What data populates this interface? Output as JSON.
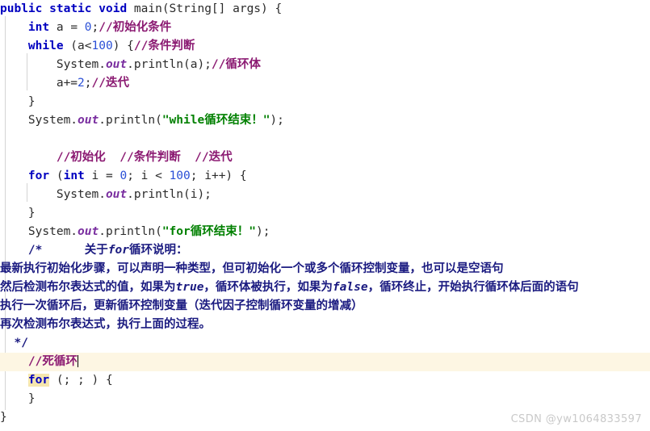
{
  "editor": {
    "language": "java",
    "background_color": "#ffffff",
    "current_line_highlight_color": "#fdf6e3",
    "bracket_match_color": "#f5e6ae",
    "indent_guide_color": "#d4d4d4",
    "colors": {
      "keyword": "#0000c0",
      "number": "#2a4fd6",
      "string": "#008000",
      "line_comment": "#8b1a72",
      "block_comment": "#1a1a80",
      "static_field": "#7a2fa0",
      "plain_text": "#2b2b2b"
    }
  },
  "code_lines": [
    {
      "n": 1,
      "tokens": [
        {
          "t": "public",
          "c": "kw"
        },
        {
          "t": " ",
          "c": "plain"
        },
        {
          "t": "static",
          "c": "kw"
        },
        {
          "t": " ",
          "c": "plain"
        },
        {
          "t": "void",
          "c": "kw"
        },
        {
          "t": " main(String[] args) {",
          "c": "plain"
        }
      ],
      "text": "public static void main(String[] args) {"
    },
    {
      "n": 2,
      "tokens": [
        {
          "t": "    ",
          "c": "plain"
        },
        {
          "t": "int",
          "c": "kw"
        },
        {
          "t": " a = ",
          "c": "plain"
        },
        {
          "t": "0",
          "c": "num"
        },
        {
          "t": ";",
          "c": "plain"
        },
        {
          "t": "//初始化条件",
          "c": "cmt"
        }
      ],
      "text": "    int a = 0;//初始化条件"
    },
    {
      "n": 3,
      "tokens": [
        {
          "t": "    ",
          "c": "plain"
        },
        {
          "t": "while",
          "c": "kw"
        },
        {
          "t": " (a<",
          "c": "plain"
        },
        {
          "t": "100",
          "c": "num"
        },
        {
          "t": ") {",
          "c": "plain"
        },
        {
          "t": "//条件判断",
          "c": "cmt"
        }
      ],
      "text": "    while (a<100) {//条件判断"
    },
    {
      "n": 4,
      "tokens": [
        {
          "t": "        System.",
          "c": "plain"
        },
        {
          "t": "out",
          "c": "fld"
        },
        {
          "t": ".println(a);",
          "c": "plain"
        },
        {
          "t": "//循环体",
          "c": "cmt"
        }
      ],
      "text": "        System.out.println(a);//循环体"
    },
    {
      "n": 5,
      "tokens": [
        {
          "t": "        a+=",
          "c": "plain"
        },
        {
          "t": "2",
          "c": "num"
        },
        {
          "t": ";",
          "c": "plain"
        },
        {
          "t": "//迭代",
          "c": "cmt"
        }
      ],
      "text": "        a+=2;//迭代"
    },
    {
      "n": 6,
      "tokens": [
        {
          "t": "    }",
          "c": "plain"
        }
      ],
      "text": "    }"
    },
    {
      "n": 7,
      "tokens": [
        {
          "t": "    System.",
          "c": "plain"
        },
        {
          "t": "out",
          "c": "fld"
        },
        {
          "t": ".println(",
          "c": "plain"
        },
        {
          "t": "\"while循环结束！\"",
          "c": "str"
        },
        {
          "t": ");",
          "c": "plain"
        }
      ],
      "text": "    System.out.println(\"while循环结束！\");"
    },
    {
      "n": 8,
      "tokens": [],
      "text": ""
    },
    {
      "n": 9,
      "tokens": [
        {
          "t": "        ",
          "c": "plain"
        },
        {
          "t": "//初始化  //条件判断  //迭代",
          "c": "cmt"
        }
      ],
      "text": "        //初始化  //条件判断  //迭代"
    },
    {
      "n": 10,
      "tokens": [
        {
          "t": "    ",
          "c": "plain"
        },
        {
          "t": "for",
          "c": "kw"
        },
        {
          "t": " (",
          "c": "plain"
        },
        {
          "t": "int",
          "c": "kw"
        },
        {
          "t": " i = ",
          "c": "plain"
        },
        {
          "t": "0",
          "c": "num"
        },
        {
          "t": "; i < ",
          "c": "plain"
        },
        {
          "t": "100",
          "c": "num"
        },
        {
          "t": "; i++) {",
          "c": "plain"
        }
      ],
      "text": "    for (int i = 0; i < 100; i++) {"
    },
    {
      "n": 11,
      "tokens": [
        {
          "t": "        System.",
          "c": "plain"
        },
        {
          "t": "out",
          "c": "fld"
        },
        {
          "t": ".println(i);",
          "c": "plain"
        }
      ],
      "text": "        System.out.println(i);"
    },
    {
      "n": 12,
      "tokens": [
        {
          "t": "    }",
          "c": "plain"
        }
      ],
      "text": "    }"
    },
    {
      "n": 13,
      "tokens": [
        {
          "t": "    System.",
          "c": "plain"
        },
        {
          "t": "out",
          "c": "fld"
        },
        {
          "t": ".println(",
          "c": "plain"
        },
        {
          "t": "\"for循环结束！\"",
          "c": "str"
        },
        {
          "t": ");",
          "c": "plain"
        }
      ],
      "text": "    System.out.println(\"for循环结束！\");"
    },
    {
      "n": 14,
      "tokens": [
        {
          "t": "    ",
          "c": "plain"
        },
        {
          "t": "/*      关于",
          "c": "blk"
        },
        {
          "t": "for",
          "c": "blk-i"
        },
        {
          "t": "循环说明：",
          "c": "blk"
        }
      ],
      "text": "    /*      关于for循环说明："
    },
    {
      "n": 15,
      "prose": true,
      "tokens": [
        {
          "t": "最新执行初始化步骤，可以声明一种类型，但可初始化一个或多个循环控制变量，也可以是空语句",
          "c": "blk"
        }
      ],
      "text": "最新执行初始化步骤，可以声明一种类型，但可初始化一个或多个循环控制变量，也可以是空语句"
    },
    {
      "n": 16,
      "prose": true,
      "tokens": [
        {
          "t": "然后检测布尔表达式的值，如果为",
          "c": "blk"
        },
        {
          "t": "true",
          "c": "blk-i"
        },
        {
          "t": "，循环体被执行，如果为",
          "c": "blk"
        },
        {
          "t": "false",
          "c": "blk-i"
        },
        {
          "t": "，循环终止，开始执行循环体后面的语句",
          "c": "blk"
        }
      ],
      "text": "然后检测布尔表达式的值，如果为true，循环体被执行，如果为false，循环终止，开始执行循环体后面的语句"
    },
    {
      "n": 17,
      "prose": true,
      "tokens": [
        {
          "t": "执行一次循环后，更新循环控制变量（迭代因子控制循环变量的增减）",
          "c": "blk"
        }
      ],
      "text": "执行一次循环后，更新循环控制变量（迭代因子控制循环变量的增减）"
    },
    {
      "n": 18,
      "prose": true,
      "tokens": [
        {
          "t": "再次检测布尔表达式，执行上面的过程。",
          "c": "blk"
        }
      ],
      "text": "再次检测布尔表达式，执行上面的过程。"
    },
    {
      "n": 19,
      "tokens": [
        {
          "t": "  ",
          "c": "plain"
        },
        {
          "t": "*/",
          "c": "blk"
        }
      ],
      "text": "  */"
    },
    {
      "n": 20,
      "current": true,
      "caret": true,
      "tokens": [
        {
          "t": "    ",
          "c": "plain"
        },
        {
          "t": "//死循环",
          "c": "cmt"
        }
      ],
      "text": "    //死循环"
    },
    {
      "n": 21,
      "tokens": [
        {
          "t": "    ",
          "c": "plain"
        },
        {
          "t": "for",
          "c": "kw-hl"
        },
        {
          "t": " (; ; ) {",
          "c": "plain"
        }
      ],
      "text": "    for (; ; ) {"
    },
    {
      "n": 22,
      "tokens": [
        {
          "t": "    }",
          "c": "plain"
        }
      ],
      "text": "    }"
    },
    {
      "n": 23,
      "tokens": [
        {
          "t": "}",
          "c": "plain"
        }
      ],
      "text": "}"
    }
  ],
  "watermark": {
    "text": "CSDN @yw1064833597"
  }
}
